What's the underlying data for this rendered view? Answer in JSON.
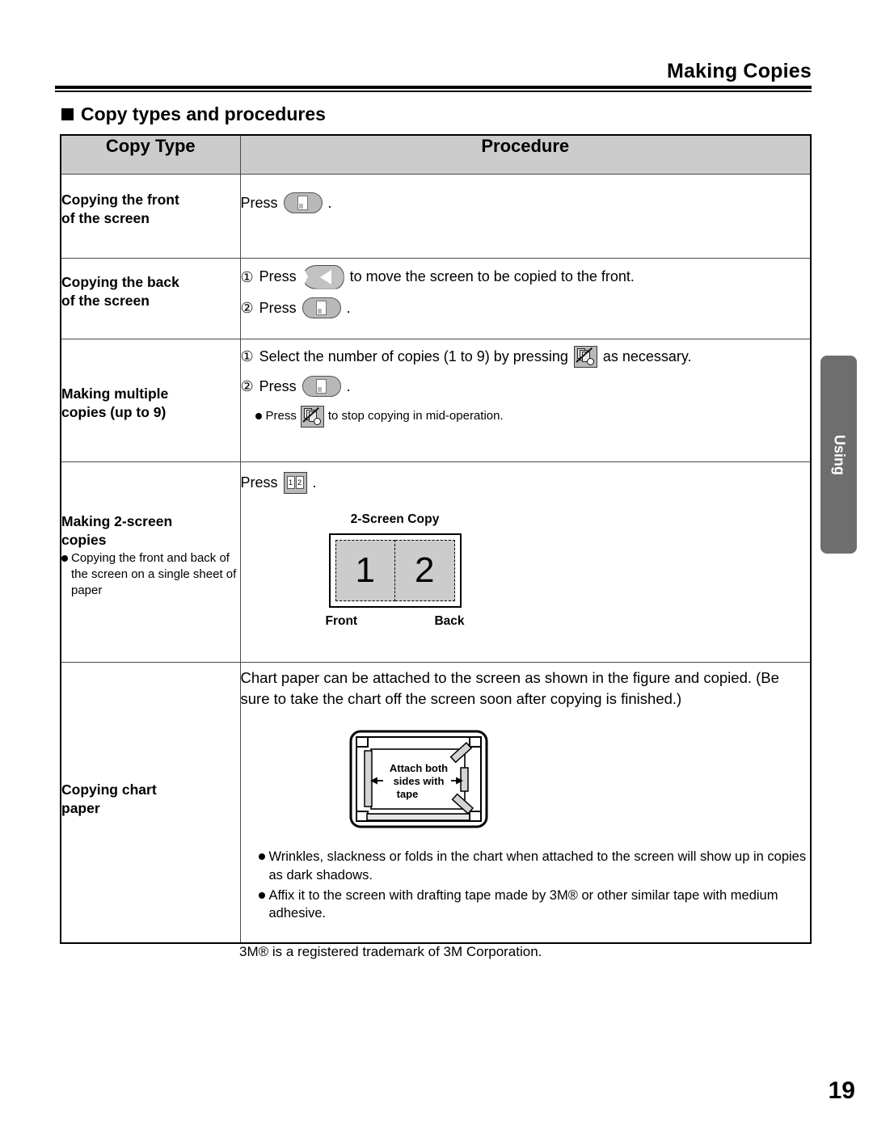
{
  "header": {
    "title": "Making Copies"
  },
  "section": {
    "heading": "Copy types and procedures",
    "bullet_icon": "square-bullet-icon"
  },
  "table": {
    "columns": [
      "Copy Type",
      "Procedure"
    ],
    "rows": [
      {
        "type": "Copying the front\nof the screen",
        "type_line1": "Copying the front",
        "type_line2": "of the screen",
        "steps": [
          {
            "num": "",
            "pre": "Press",
            "icon": "copy-button-icon",
            "post": "."
          }
        ]
      },
      {
        "type_line1": "Copying the back",
        "type_line2": "of the screen",
        "steps": [
          {
            "num": "①",
            "pre": "Press",
            "icon": "screen-move-arrow-button-icon",
            "post": "to move the screen to be copied to the front."
          },
          {
            "num": "②",
            "pre": "Press",
            "icon": "copy-button-icon",
            "post": "."
          }
        ]
      },
      {
        "type_line1": "Making multiple",
        "type_line2": "copies (up to 9)",
        "steps": [
          {
            "num": "①",
            "pre": "Select the number of copies (1 to 9) by pressing",
            "icon": "copies-stop-button-icon",
            "post": "as necessary."
          },
          {
            "num": "②",
            "pre": "Press",
            "icon": "copy-button-icon",
            "post": "."
          }
        ],
        "note": {
          "pre": "Press",
          "icon": "copies-stop-button-icon",
          "post": "to stop copying in mid-operation."
        }
      },
      {
        "type_line1": "Making 2-screen",
        "type_line2": "copies",
        "type_note": "Copying the front and back of the screen on a single sheet of paper",
        "steps": [
          {
            "num": "",
            "pre": "Press",
            "icon": "two-screen-copy-button-icon",
            "post": "."
          }
        ],
        "figure": {
          "title": "2-Screen Copy",
          "panel_left": "1",
          "panel_right": "2",
          "label_left": "Front",
          "label_right": "Back"
        }
      },
      {
        "type_line1": "Copying chart",
        "type_line2": "paper",
        "paragraph": "Chart paper can be attached to the screen as shown in the figure and copied. (Be sure to take the chart off the screen soon after copying is finished.)",
        "figure": {
          "caption_line1": "Attach both",
          "caption_line2": "sides with",
          "caption_line3": "tape",
          "arrow_left": "←",
          "arrow_right": "→"
        },
        "notes": [
          "Wrinkles, slackness or folds in the chart when attached to the screen will show up in copies as dark shadows.",
          "Affix it to the screen with drafting tape made by 3M® or other similar tape with medium adhesive."
        ]
      }
    ]
  },
  "trademark": "3M® is a registered trademark of 3M Corporation.",
  "side_tab": {
    "label": "Using",
    "color": "#6e6e6e"
  },
  "page_number": "19",
  "colors": {
    "header_fill": "#cccccc",
    "panel_fill": "#cccccc",
    "button_fill": "#b8b8b8",
    "tab_fill": "#6e6e6e"
  }
}
